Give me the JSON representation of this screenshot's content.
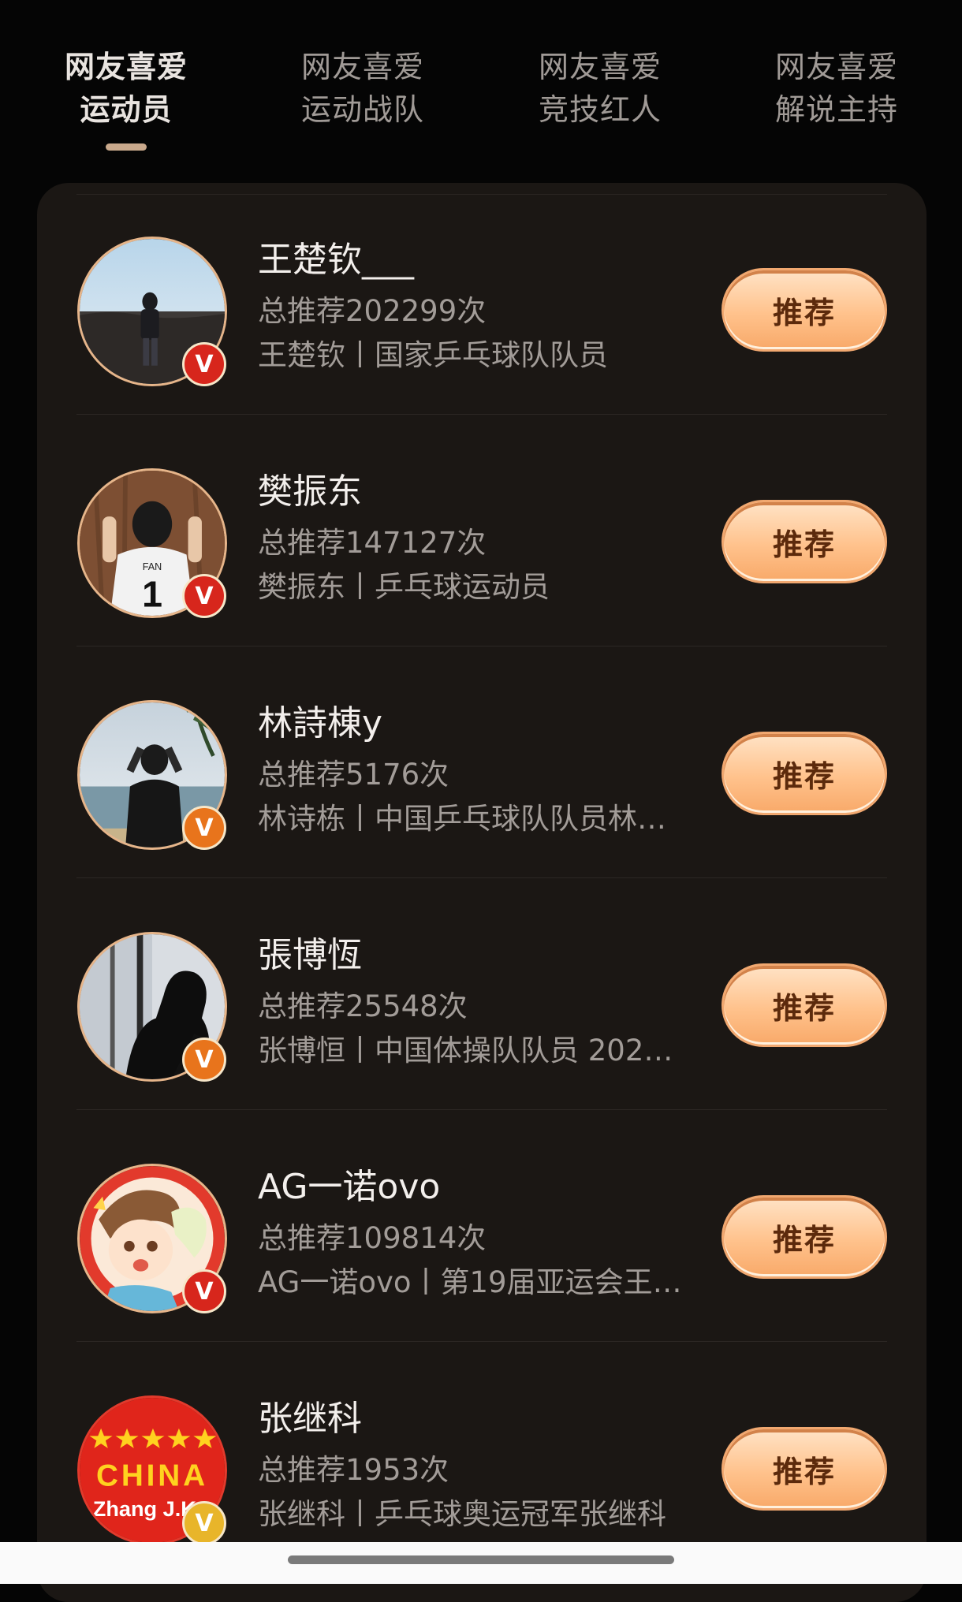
{
  "tabs": [
    {
      "line1": "网友喜爱",
      "line2": "运动员",
      "active": true
    },
    {
      "line1": "网友喜爱",
      "line2": "运动战队",
      "active": false
    },
    {
      "line1": "网友喜爱",
      "line2": "竞技红人",
      "active": false
    },
    {
      "line1": "网友喜爱",
      "line2": "解说主持",
      "active": false
    }
  ],
  "list": [
    {
      "name": "王楚钦___",
      "count": "总推荐202299次",
      "desc": "王楚钦丨国家乒乓球队队员",
      "button": "推荐",
      "badge": "V"
    },
    {
      "name": "樊振东",
      "count": "总推荐147127次",
      "desc": "樊振东丨乒乓球运动员",
      "button": "推荐",
      "badge": "V"
    },
    {
      "name": "林詩棟y",
      "count": "总推荐5176次",
      "desc": "林诗栋丨中国乒乓球队队员林…",
      "button": "推荐",
      "badge": "V"
    },
    {
      "name": "張博恆",
      "count": "总推荐25548次",
      "desc": "张博恒丨中国体操队队员 202…",
      "button": "推荐",
      "badge": "V"
    },
    {
      "name": "AG一诺ovo",
      "count": "总推荐109814次",
      "desc": "AG一诺ovo丨第19届亚运会王…",
      "button": "推荐",
      "badge": "V"
    },
    {
      "name": "张继科",
      "count": "总推荐1953次",
      "desc": "张继科丨乒乓球奥运冠军张继科",
      "button": "推荐",
      "badge": "V"
    }
  ],
  "avatar_text": {
    "jersey": "FAN",
    "jersey_number": "1",
    "china": "CHINA",
    "zhang": "Zhang J.K"
  },
  "colors": {
    "background": "#050505",
    "card": "#1b1714",
    "button_gradient_top": "#ffe3c6",
    "button_gradient_bottom": "#f8a969",
    "badge_orange": "#e8741c",
    "badge_red": "#d7261c",
    "badge_gold": "#e8b52a"
  }
}
